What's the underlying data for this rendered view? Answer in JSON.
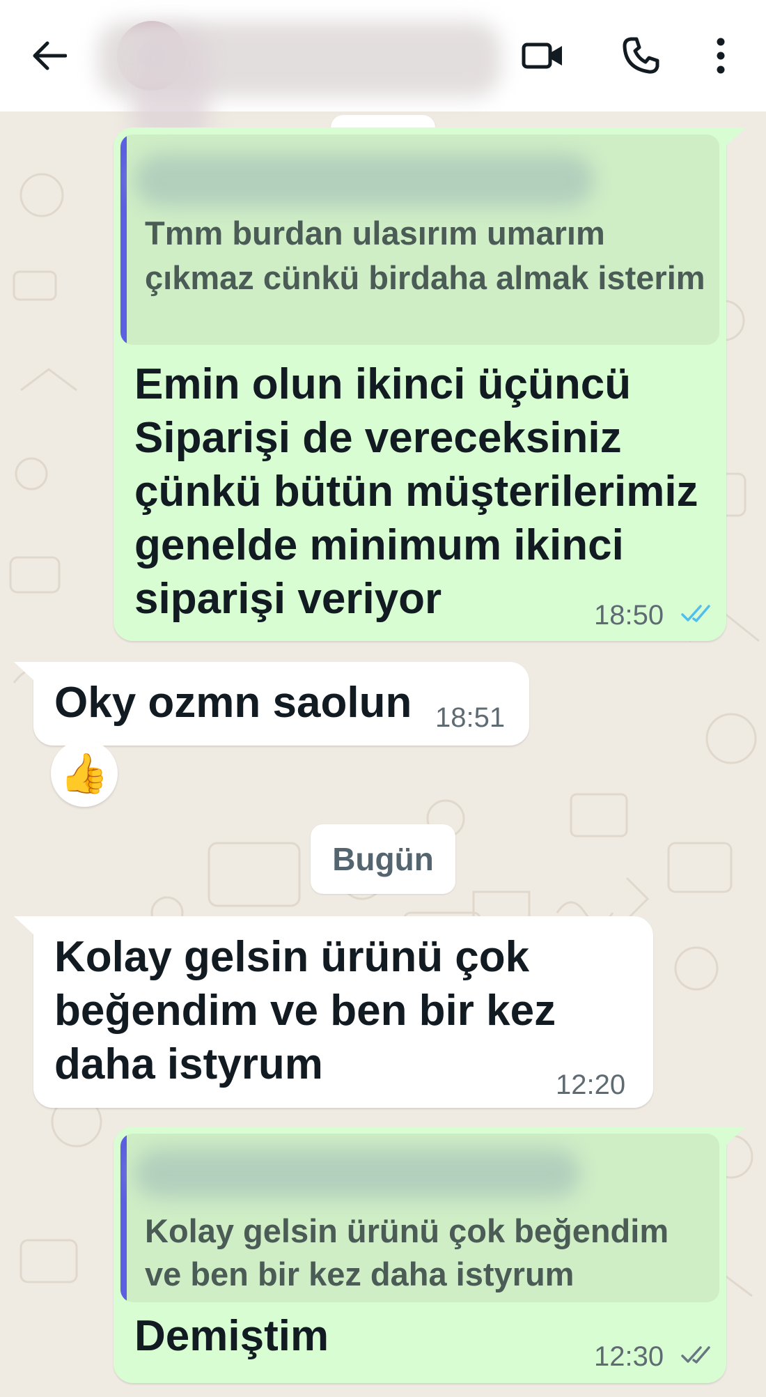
{
  "header": {
    "back_icon": "arrow-left-icon",
    "contact_name": "",
    "video_icon": "video-camera-icon",
    "call_icon": "phone-icon",
    "menu_icon": "more-vertical-icon"
  },
  "messages": [
    {
      "direction": "outgoing",
      "quoted_text": "Tmm burdan ulasırım umarım çıkmaz cünkü birdaha almak isterim",
      "text_lines": [
        "Emin olun ikinci üçüncü",
        "Siparişi de vereceksiniz",
        "çünkü bütün müşterilerimiz",
        "genelde minimum ikinci",
        "siparişi veriyor"
      ],
      "time": "18:50",
      "status": "read"
    },
    {
      "direction": "incoming",
      "text": "Oky ozmn saolun",
      "time": "18:51",
      "reaction": "👍"
    },
    {
      "direction": "incoming",
      "text_lines": [
        "Kolay gelsin ürünü çok",
        "beğendim ve ben bir kez",
        "daha istyrum"
      ],
      "time": "12:20"
    },
    {
      "direction": "outgoing",
      "quoted_text_lines": [
        "Kolay gelsin ürünü çok beğendim",
        "ve ben bir kez daha istyrum"
      ],
      "text": "Demiştim",
      "time": "12:30",
      "status": "delivered"
    }
  ],
  "date_separator": "Bugün",
  "colors": {
    "outgoing_bubble": "#d9fdd3",
    "incoming_bubble": "#ffffff",
    "quote_bar": "#5b5fe0",
    "read_tick": "#53bdeb",
    "chat_background": "#efeae2"
  }
}
